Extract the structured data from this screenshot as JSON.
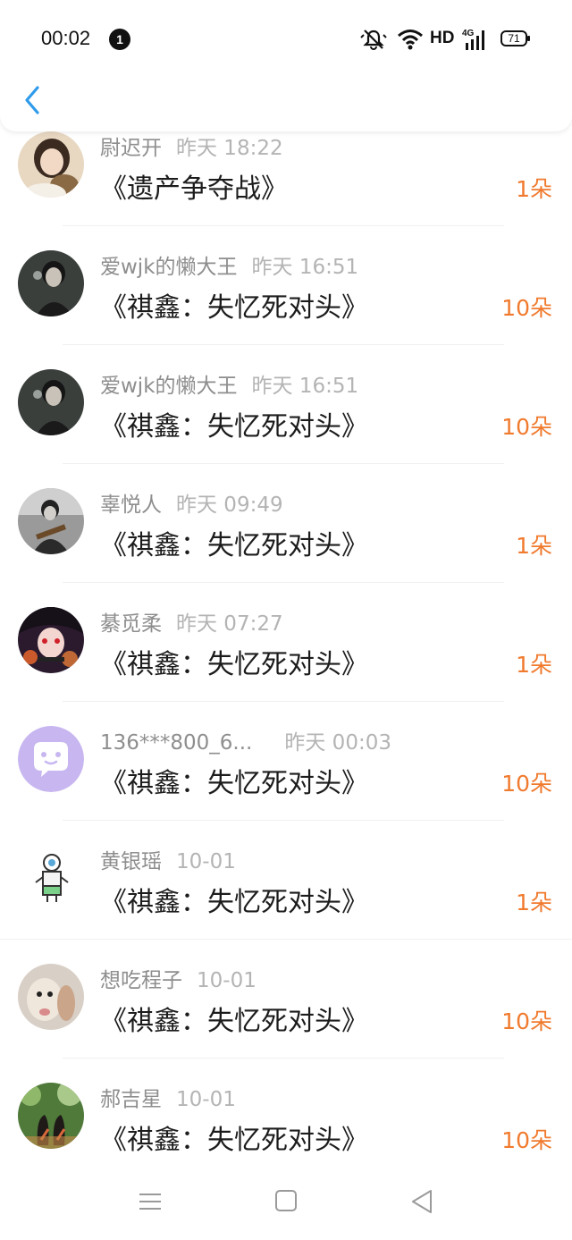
{
  "status_bar": {
    "time": "00:02",
    "notification_count": "1",
    "network_label": "HD",
    "signal_label": "4G",
    "battery_level": "71"
  },
  "header": {
    "back_icon": "chevron-left-icon",
    "accent_color": "#2f9bea"
  },
  "colors": {
    "flower_count": "#f07a2e",
    "username": "#8e8e8e",
    "timestamp": "#b4b4b4",
    "title": "#1c1c1c"
  },
  "records": [
    {
      "username": "尉迟开",
      "time": "昨天 18:22",
      "book": "《遗产争夺战》",
      "count": "1朵"
    },
    {
      "username": "爱wjk的懒大王",
      "time": "昨天 16:51",
      "book": "《祺鑫：失忆死对头》",
      "count": "10朵"
    },
    {
      "username": "爱wjk的懒大王",
      "time": "昨天 16:51",
      "book": "《祺鑫：失忆死对头》",
      "count": "10朵"
    },
    {
      "username": "辜悦人",
      "time": "昨天 09:49",
      "book": "《祺鑫：失忆死对头》",
      "count": "1朵"
    },
    {
      "username": "綦觅柔",
      "time": "昨天 07:27",
      "book": "《祺鑫：失忆死对头》",
      "count": "1朵"
    },
    {
      "username": "136***800_6...",
      "time": "昨天 00:03",
      "book": "《祺鑫：失忆死对头》",
      "count": "10朵"
    },
    {
      "username": "黄银瑶",
      "time": "10-01",
      "book": "《祺鑫：失忆死对头》",
      "count": "1朵"
    },
    {
      "username": "想吃程子",
      "time": "10-01",
      "book": "《祺鑫：失忆死对头》",
      "count": "10朵"
    },
    {
      "username": "郝吉星",
      "time": "10-01",
      "book": "《祺鑫：失忆死对头》",
      "count": "10朵"
    }
  ],
  "nav": {
    "menu_icon": "menu-icon",
    "home_icon": "home-square-icon",
    "back_icon": "back-triangle-icon"
  }
}
